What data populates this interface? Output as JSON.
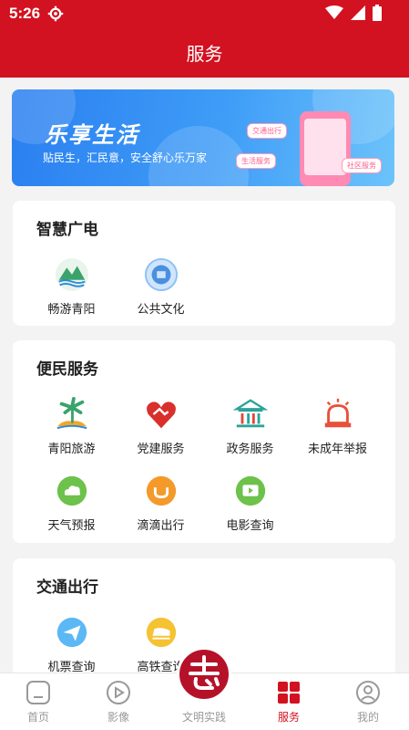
{
  "status_bar": {
    "time": "5:26"
  },
  "header": {
    "title": "服务"
  },
  "banner": {
    "title": "乐享生活",
    "subtitle": "贴民生，汇民意，安全舒心乐万家",
    "tags": [
      "交通出行",
      "生活服务",
      "社区服务"
    ]
  },
  "sections": [
    {
      "title": "智慧广电",
      "items": [
        {
          "label": "畅游青阳",
          "icon": "landscape-icon"
        },
        {
          "label": "公共文化",
          "icon": "culture-icon"
        }
      ]
    },
    {
      "title": "便民服务",
      "items": [
        {
          "label": "青阳旅游",
          "icon": "palm-tree-icon"
        },
        {
          "label": "党建服务",
          "icon": "heart-handshake-icon"
        },
        {
          "label": "政务服务",
          "icon": "government-building-icon"
        },
        {
          "label": "未成年举报",
          "icon": "alarm-icon"
        },
        {
          "label": "天气预报",
          "icon": "cloud-icon"
        },
        {
          "label": "滴滴出行",
          "icon": "didi-icon"
        },
        {
          "label": "电影查询",
          "icon": "tv-icon"
        }
      ]
    },
    {
      "title": "交通出行",
      "items": [
        {
          "label": "机票查询",
          "icon": "paper-plane-icon"
        },
        {
          "label": "高铁查询",
          "icon": "train-icon"
        }
      ]
    }
  ],
  "tabbar": {
    "items": [
      {
        "label": "首页",
        "icon": "home-icon",
        "active": false
      },
      {
        "label": "影像",
        "icon": "play-icon",
        "active": false
      },
      {
        "label": "文明实践",
        "icon": "emblem-icon",
        "active": false
      },
      {
        "label": "服务",
        "icon": "grid-icon",
        "active": true
      },
      {
        "label": "我的",
        "icon": "profile-icon",
        "active": false
      }
    ]
  },
  "colors": {
    "brand_red": "#d21220",
    "active_tab": "#d21220",
    "inactive_tab": "#999999"
  }
}
